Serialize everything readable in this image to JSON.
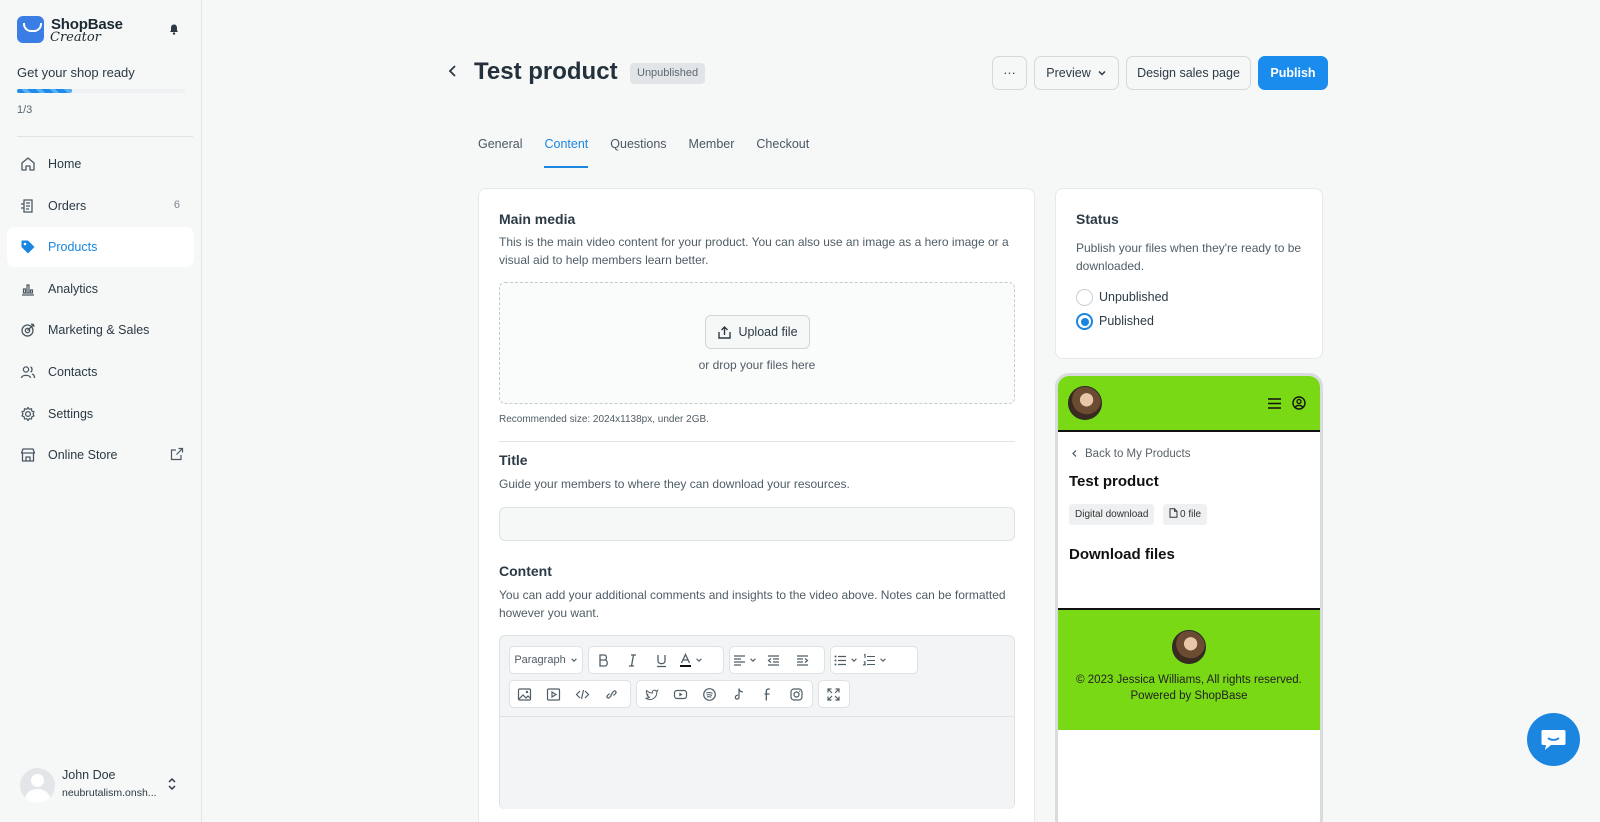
{
  "sidebar": {
    "brand": {
      "name": "ShopBase",
      "tagline": "Creator"
    },
    "onboarding": {
      "title": "Get your shop ready",
      "steps": "1/3",
      "progress": 0.33
    },
    "items": [
      {
        "label": "Home",
        "icon": "home-icon"
      },
      {
        "label": "Orders",
        "icon": "orders-icon",
        "badge": "6"
      },
      {
        "label": "Products",
        "icon": "tag-icon",
        "active": true
      },
      {
        "label": "Analytics",
        "icon": "analytics-icon"
      },
      {
        "label": "Marketing & Sales",
        "icon": "target-icon"
      },
      {
        "label": "Contacts",
        "icon": "contacts-icon"
      },
      {
        "label": "Settings",
        "icon": "gear-icon"
      },
      {
        "label": "Online Store",
        "icon": "store-icon"
      }
    ],
    "user": {
      "name": "John Doe",
      "shop": "neubrutalism.onsh..."
    }
  },
  "header": {
    "title": "Test product",
    "status_badge": "Unpublished",
    "more_label": "···",
    "preview_label": "Preview",
    "design_label": "Design sales page",
    "publish_label": "Publish"
  },
  "tabs": [
    {
      "label": "General"
    },
    {
      "label": "Content",
      "active": true
    },
    {
      "label": "Questions"
    },
    {
      "label": "Member"
    },
    {
      "label": "Checkout"
    }
  ],
  "main": {
    "media": {
      "title": "Main media",
      "description": "This is the main video content for your product. You can also use an image as a hero image or a visual aid to help members learn better.",
      "upload_label": "Upload file",
      "drop_text": "or drop your files here",
      "recommended": "Recommended size: 2024x1138px, under 2GB."
    },
    "title_section": {
      "title": "Title",
      "description": "Guide your members to where they can download your resources.",
      "value": ""
    },
    "content_section": {
      "title": "Content",
      "description": "You can add your additional comments and insights to the video above. Notes can be formatted however you want.",
      "paragraph_label": "Paragraph"
    }
  },
  "status_card": {
    "title": "Status",
    "description": "Publish your files when they're ready to be downloaded.",
    "options": [
      {
        "label": "Unpublished",
        "checked": false
      },
      {
        "label": "Published",
        "checked": true
      }
    ]
  },
  "preview": {
    "back_label": "Back to My Products",
    "product_title": "Test product",
    "tag_type": "Digital download",
    "tag_files": "0 file",
    "section_title": "Download files",
    "footer_copyright": "© 2023 Jessica Williams, All rights reserved.",
    "footer_powered": "Powered by ShopBase"
  },
  "colors": {
    "accent": "#1a86e0",
    "publish": "#1a8cee",
    "preview_green": "#79d915",
    "background": "#f6f7f7"
  }
}
